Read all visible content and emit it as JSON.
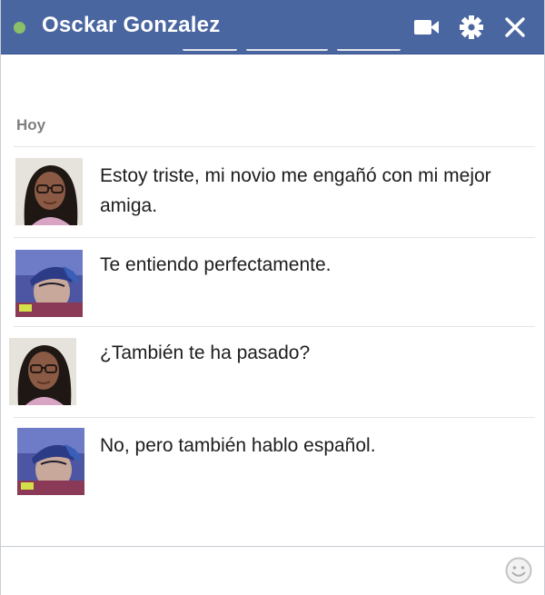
{
  "header": {
    "contact_name": "Osckar Gonzalez",
    "status_color": "#8cc068",
    "background_color": "#4a66a0",
    "icons": [
      "video-camera-icon",
      "gear-icon",
      "close-icon"
    ]
  },
  "conversation": {
    "day_label": "Hoy",
    "messages": [
      {
        "sender": "girl",
        "avatar": "girl-avatar",
        "text": "Estoy triste, mi novio me engañó con mi mejor amiga."
      },
      {
        "sender": "boy",
        "avatar": "boy-avatar",
        "text": "Te entiendo perfectamente."
      },
      {
        "sender": "girl",
        "avatar": "girl-avatar",
        "text": "¿También te ha pasado?"
      },
      {
        "sender": "boy",
        "avatar": "boy-avatar",
        "text": "No, pero también hablo español."
      }
    ]
  },
  "composer": {
    "icons": [
      "smiley-icon"
    ]
  }
}
